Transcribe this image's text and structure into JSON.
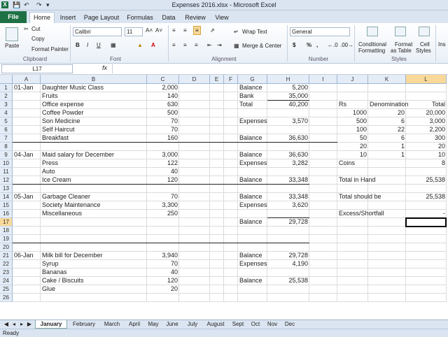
{
  "app": {
    "window_title": "Expenses 2016.xlsx  -  Microsoft Excel",
    "logo": "X"
  },
  "tabs": {
    "file": "File",
    "items": [
      "Home",
      "Insert",
      "Page Layout",
      "Formulas",
      "Data",
      "Review",
      "View"
    ]
  },
  "ribbon": {
    "clipboard": {
      "paste": "Paste",
      "cut": "Cut",
      "copy": "Copy",
      "format_painter": "Format Painter",
      "label": "Clipboard"
    },
    "font": {
      "name": "Calibri",
      "size": "11",
      "label": "Font",
      "bold": "B",
      "italic": "I",
      "underline": "U"
    },
    "alignment": {
      "wrap": "Wrap Text",
      "merge": "Merge & Center",
      "label": "Alignment"
    },
    "number": {
      "format": "General",
      "currency": "$",
      "percent": "%",
      "comma": ",",
      "label": "Number"
    },
    "styles": {
      "conditional": "Conditional",
      "conditional2": "Formatting",
      "format_as": "Format",
      "format_as2": "as Table",
      "cell": "Cell",
      "cell2": "Styles",
      "label": "Styles"
    },
    "insert": "Ins"
  },
  "formula_bar": {
    "name_box": "L17",
    "fx": "fx",
    "value": ""
  },
  "columns": [
    "A",
    "B",
    "C",
    "D",
    "E",
    "F",
    "G",
    "H",
    "I",
    "J",
    "K",
    "L"
  ],
  "rows": [
    "1",
    "2",
    "3",
    "4",
    "5",
    "6",
    "7",
    "8",
    "9",
    "10",
    "11",
    "12",
    "13",
    "14",
    "15",
    "16",
    "17",
    "18",
    "19",
    "20",
    "21",
    "22",
    "23",
    "24",
    "25",
    "26"
  ],
  "cells": [
    {
      "r": 1,
      "c": "A",
      "v": "01-Jan"
    },
    {
      "r": 1,
      "c": "B",
      "v": "Daughter Music Class"
    },
    {
      "r": 1,
      "c": "C",
      "v": "2,000"
    },
    {
      "r": 1,
      "c": "G",
      "v": "Balance"
    },
    {
      "r": 1,
      "c": "H",
      "v": "5,200"
    },
    {
      "r": 2,
      "c": "B",
      "v": "Fruits"
    },
    {
      "r": 2,
      "c": "C",
      "v": "140"
    },
    {
      "r": 2,
      "c": "G",
      "v": "Bank"
    },
    {
      "r": 2,
      "c": "H",
      "v": "35,000"
    },
    {
      "r": 3,
      "c": "B",
      "v": "Office expense"
    },
    {
      "r": 3,
      "c": "C",
      "v": "630"
    },
    {
      "r": 3,
      "c": "G",
      "v": "Total"
    },
    {
      "r": 3,
      "c": "H",
      "v": "40,200"
    },
    {
      "r": 3,
      "c": "J",
      "v": "Rs"
    },
    {
      "r": 3,
      "c": "K",
      "v": "Denomination"
    },
    {
      "r": 3,
      "c": "L",
      "v": "Total"
    },
    {
      "r": 4,
      "c": "B",
      "v": "Coffee Powder"
    },
    {
      "r": 4,
      "c": "C",
      "v": "500"
    },
    {
      "r": 4,
      "c": "J",
      "v": "1000"
    },
    {
      "r": 4,
      "c": "K",
      "v": "20"
    },
    {
      "r": 4,
      "c": "L",
      "v": "20,000"
    },
    {
      "r": 5,
      "c": "B",
      "v": "Son Medicine"
    },
    {
      "r": 5,
      "c": "C",
      "v": "70"
    },
    {
      "r": 5,
      "c": "G",
      "v": "Expenses"
    },
    {
      "r": 5,
      "c": "H",
      "v": "3,570"
    },
    {
      "r": 5,
      "c": "J",
      "v": "500"
    },
    {
      "r": 5,
      "c": "K",
      "v": "6"
    },
    {
      "r": 5,
      "c": "L",
      "v": "3,000"
    },
    {
      "r": 6,
      "c": "B",
      "v": "Self Haircut"
    },
    {
      "r": 6,
      "c": "C",
      "v": "70"
    },
    {
      "r": 6,
      "c": "J",
      "v": "100"
    },
    {
      "r": 6,
      "c": "K",
      "v": "22"
    },
    {
      "r": 6,
      "c": "L",
      "v": "2,200"
    },
    {
      "r": 7,
      "c": "B",
      "v": "Breakfast"
    },
    {
      "r": 7,
      "c": "C",
      "v": "160"
    },
    {
      "r": 7,
      "c": "G",
      "v": "Balance"
    },
    {
      "r": 7,
      "c": "H",
      "v": "36,630"
    },
    {
      "r": 7,
      "c": "J",
      "v": "50"
    },
    {
      "r": 7,
      "c": "K",
      "v": "6"
    },
    {
      "r": 7,
      "c": "L",
      "v": "300"
    },
    {
      "r": 8,
      "c": "J",
      "v": "20"
    },
    {
      "r": 8,
      "c": "K",
      "v": "1"
    },
    {
      "r": 8,
      "c": "L",
      "v": "20"
    },
    {
      "r": 9,
      "c": "A",
      "v": "04-Jan"
    },
    {
      "r": 9,
      "c": "B",
      "v": "Maid salary for December"
    },
    {
      "r": 9,
      "c": "C",
      "v": "3,000"
    },
    {
      "r": 9,
      "c": "G",
      "v": "Balance"
    },
    {
      "r": 9,
      "c": "H",
      "v": "36,630"
    },
    {
      "r": 9,
      "c": "J",
      "v": "10"
    },
    {
      "r": 9,
      "c": "K",
      "v": "1"
    },
    {
      "r": 9,
      "c": "L",
      "v": "10"
    },
    {
      "r": 10,
      "c": "B",
      "v": "Press"
    },
    {
      "r": 10,
      "c": "C",
      "v": "122"
    },
    {
      "r": 10,
      "c": "G",
      "v": "Expenses"
    },
    {
      "r": 10,
      "c": "H",
      "v": "3,282"
    },
    {
      "r": 10,
      "c": "J",
      "v": "Coins"
    },
    {
      "r": 10,
      "c": "L",
      "v": "8"
    },
    {
      "r": 11,
      "c": "B",
      "v": "Auto"
    },
    {
      "r": 11,
      "c": "C",
      "v": "40"
    },
    {
      "r": 12,
      "c": "B",
      "v": "Ice Cream"
    },
    {
      "r": 12,
      "c": "C",
      "v": "120"
    },
    {
      "r": 12,
      "c": "G",
      "v": "Balance"
    },
    {
      "r": 12,
      "c": "H",
      "v": "33,348"
    },
    {
      "r": 12,
      "c": "J",
      "v": "Total in Hand"
    },
    {
      "r": 12,
      "c": "L",
      "v": "25,538"
    },
    {
      "r": 14,
      "c": "A",
      "v": "05-Jan"
    },
    {
      "r": 14,
      "c": "B",
      "v": "Garbage Cleaner"
    },
    {
      "r": 14,
      "c": "C",
      "v": "70"
    },
    {
      "r": 14,
      "c": "G",
      "v": "Balance"
    },
    {
      "r": 14,
      "c": "H",
      "v": "33,348"
    },
    {
      "r": 14,
      "c": "J",
      "v": "Total should be"
    },
    {
      "r": 14,
      "c": "L",
      "v": "25,538"
    },
    {
      "r": 15,
      "c": "B",
      "v": "Society Maintenance"
    },
    {
      "r": 15,
      "c": "C",
      "v": "3,300"
    },
    {
      "r": 15,
      "c": "G",
      "v": "Expenses"
    },
    {
      "r": 15,
      "c": "H",
      "v": "3,620"
    },
    {
      "r": 16,
      "c": "B",
      "v": "Miscellaneous"
    },
    {
      "r": 16,
      "c": "C",
      "v": "250"
    },
    {
      "r": 16,
      "c": "J",
      "v": "Excess/Shortfall"
    },
    {
      "r": 16,
      "c": "L",
      "v": "-"
    },
    {
      "r": 17,
      "c": "G",
      "v": "Balance"
    },
    {
      "r": 17,
      "c": "H",
      "v": "29,728"
    },
    {
      "r": 21,
      "c": "A",
      "v": "06-Jan"
    },
    {
      "r": 21,
      "c": "B",
      "v": "Milk bill for December"
    },
    {
      "r": 21,
      "c": "C",
      "v": "3,940"
    },
    {
      "r": 21,
      "c": "G",
      "v": "Balance"
    },
    {
      "r": 21,
      "c": "H",
      "v": "29,728"
    },
    {
      "r": 22,
      "c": "B",
      "v": "Syrup"
    },
    {
      "r": 22,
      "c": "C",
      "v": "70"
    },
    {
      "r": 22,
      "c": "G",
      "v": "Expenses"
    },
    {
      "r": 22,
      "c": "H",
      "v": "4,190"
    },
    {
      "r": 23,
      "c": "B",
      "v": "Bananas"
    },
    {
      "r": 23,
      "c": "C",
      "v": "40"
    },
    {
      "r": 24,
      "c": "B",
      "v": "Cake / Biscuits"
    },
    {
      "r": 24,
      "c": "C",
      "v": "120"
    },
    {
      "r": 24,
      "c": "G",
      "v": "Balance"
    },
    {
      "r": 24,
      "c": "H",
      "v": "25,538"
    },
    {
      "r": 25,
      "c": "B",
      "v": "Glue"
    },
    {
      "r": 25,
      "c": "C",
      "v": "20"
    }
  ],
  "sheets": [
    "January",
    "February",
    "March",
    "April",
    "May",
    "June",
    "July",
    "August",
    "Sept",
    "Oct",
    "Nov",
    "Dec"
  ],
  "active_sheet": "January",
  "status": "Ready",
  "colors": {
    "excel_green": "#1e7145",
    "selected_header": "#f9d99a"
  }
}
